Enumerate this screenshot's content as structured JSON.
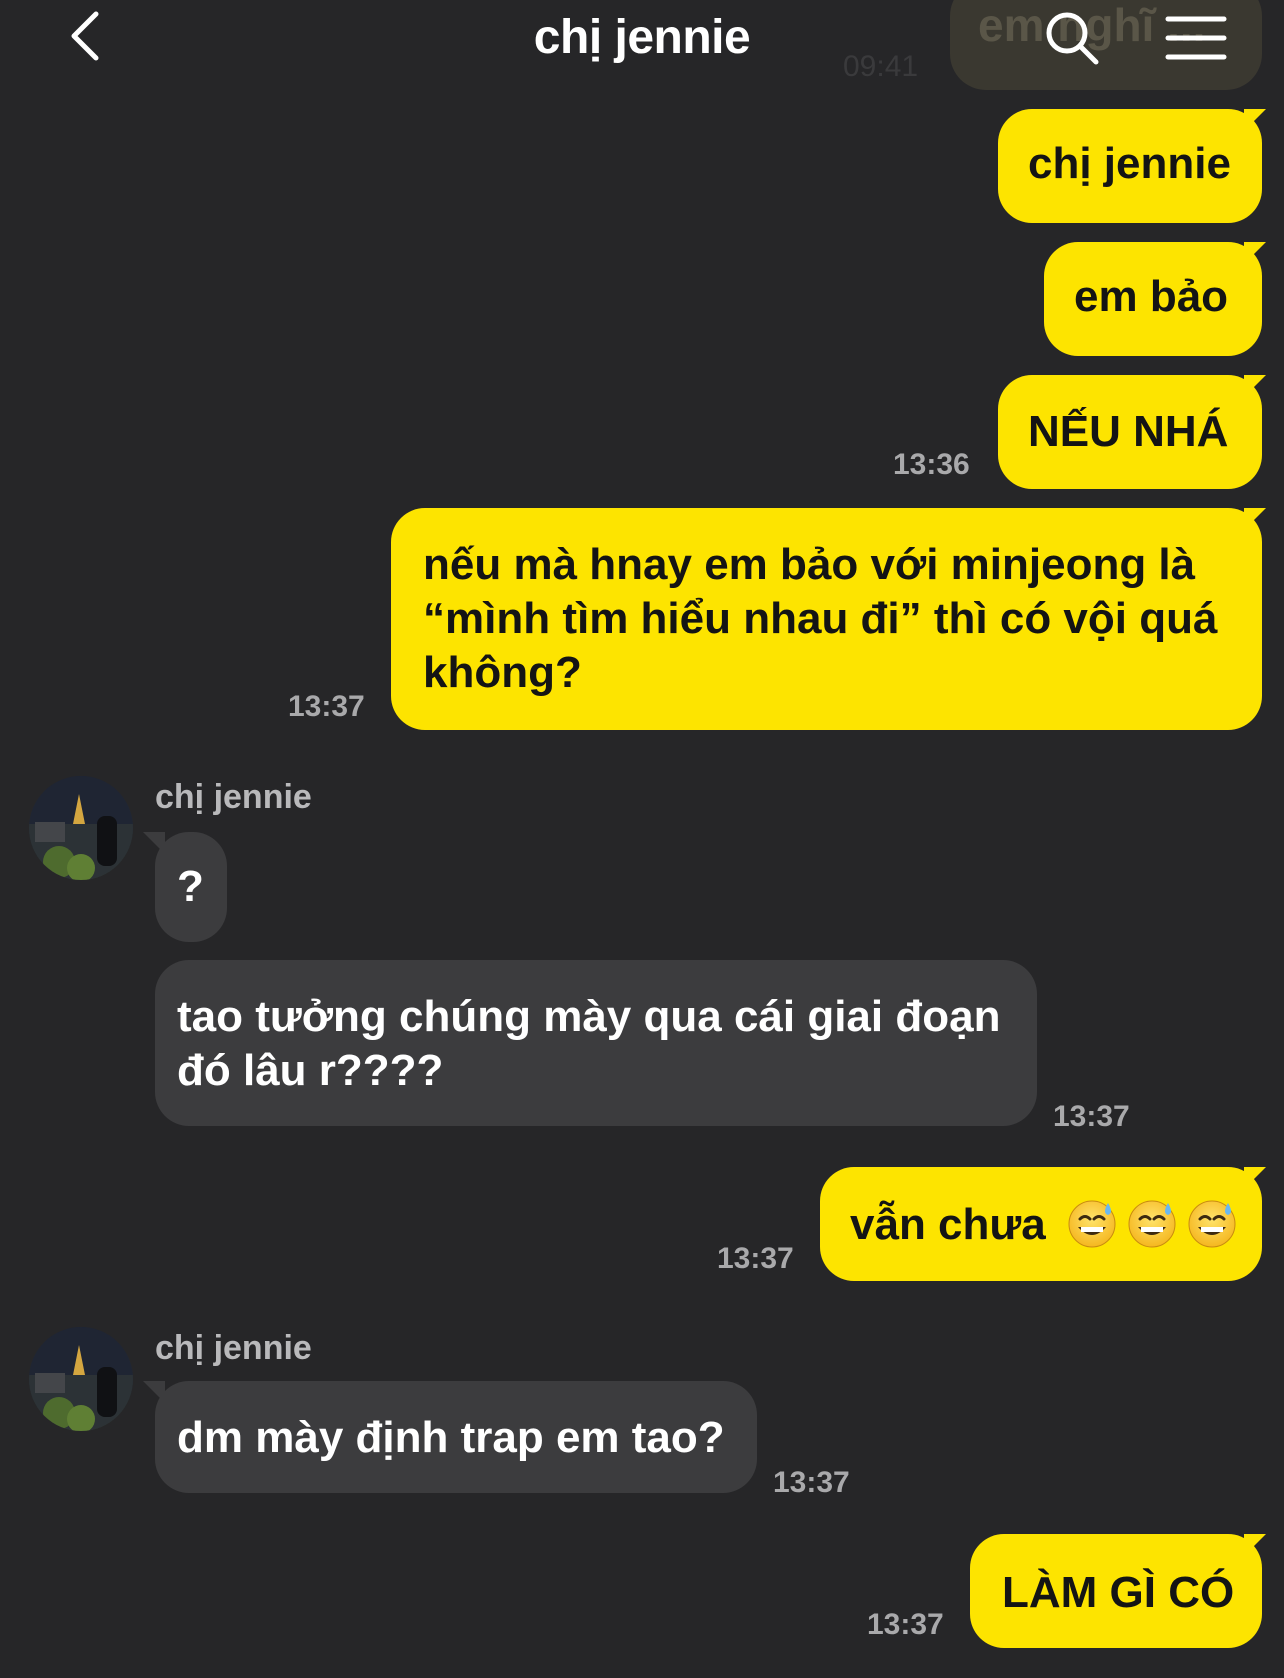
{
  "header": {
    "title": "chị jennie",
    "ghost_message": "em nghĩ ...",
    "ghost_time": "09:41"
  },
  "colors": {
    "background": "#262628",
    "my_bubble": "#fde400",
    "their_bubble": "#3c3c3e",
    "timestamp": "#a9a9ab"
  },
  "messages": [
    {
      "from": "me",
      "text": "chị jennie",
      "time": ""
    },
    {
      "from": "me",
      "text": "em bảo",
      "time": ""
    },
    {
      "from": "me",
      "text": "NẾU NHÁ",
      "time": "13:36"
    },
    {
      "from": "me",
      "text": "nếu mà hnay em bảo với minjeong là “mình tìm hiểu nhau đi” thì có vội quá không?",
      "time": "13:37"
    },
    {
      "from": "them",
      "sender": "chị jennie",
      "text": "?",
      "time": ""
    },
    {
      "from": "them",
      "text": "tao tưởng chúng mày qua cái giai đoạn đó lâu r????",
      "time": "13:37"
    },
    {
      "from": "me",
      "text": "vẫn chưa",
      "emoji": "sweat-smile-icon",
      "emoji_count": 3,
      "time": "13:37"
    },
    {
      "from": "them",
      "sender": "chị jennie",
      "text": "dm mày định trap em tao?",
      "time": "13:37"
    },
    {
      "from": "me",
      "text": "LÀM GÌ CÓ",
      "time": "13:37"
    }
  ]
}
